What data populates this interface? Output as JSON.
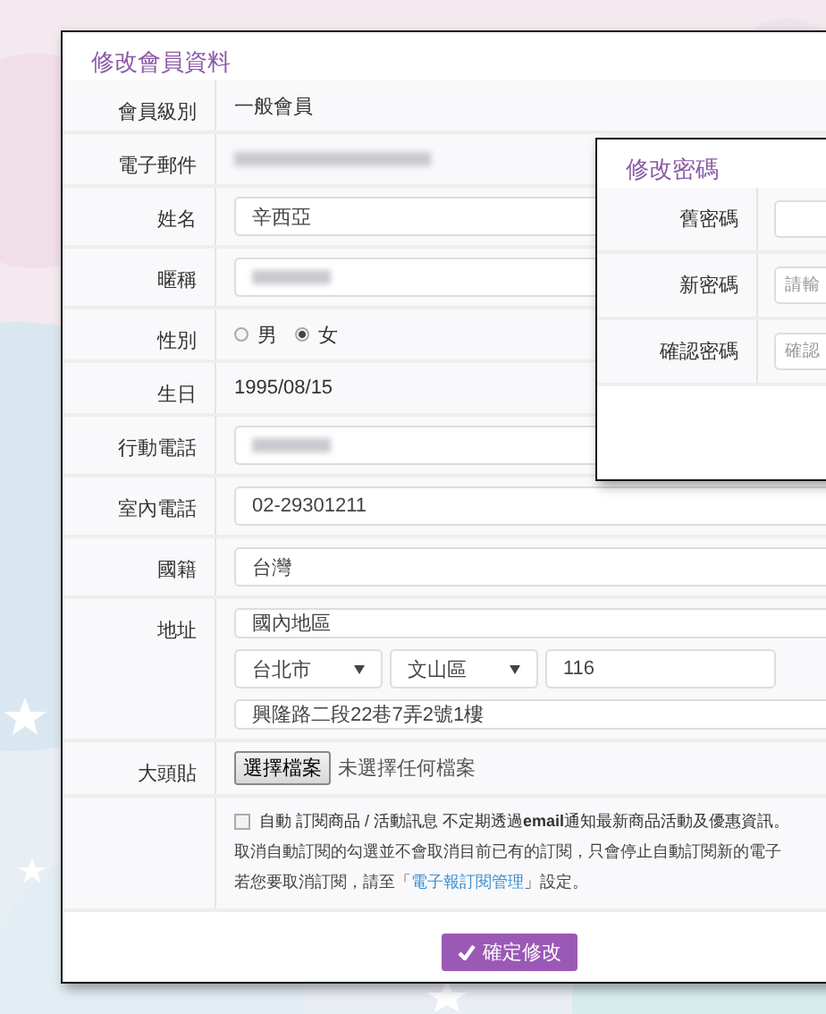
{
  "profile_dialog": {
    "title": "修改會員資料",
    "rows": [
      {
        "label": "會員級別",
        "kind": "text",
        "value": "一般會員"
      },
      {
        "label": "電子郵件",
        "kind": "blurred"
      },
      {
        "label": "姓名",
        "kind": "input",
        "value": "辛西亞"
      },
      {
        "label": "暱稱",
        "kind": "blurred_input"
      },
      {
        "label": "性別",
        "kind": "radio",
        "options": [
          {
            "label": "男",
            "selected": false
          },
          {
            "label": "女",
            "selected": true
          }
        ]
      },
      {
        "label": "生日",
        "kind": "text",
        "value": "1995/08/15"
      },
      {
        "label": "行動電話",
        "kind": "blurred_input"
      },
      {
        "label": "室內電話",
        "kind": "input",
        "value": "02-29301211"
      },
      {
        "label": "國籍",
        "kind": "input",
        "value": "台灣"
      },
      {
        "label": "地址",
        "kind": "address",
        "region": "國內地區",
        "city": "台北市",
        "district": "文山區",
        "zip": "116",
        "street": "興隆路二段22巷7弄2號1樓"
      },
      {
        "label": "大頭貼",
        "kind": "file",
        "button": "選擇檔案",
        "status": "未選擇任何檔案"
      },
      {
        "kind": "subscribe",
        "checked": false,
        "text": "自動 訂閱商品 / 活動訊息 不定期透過**email**通知最新商品活動及優惠資訊。",
        "note": "取消自動訂閱的勾選並不會取消目前已有的訂閱，只會停止自動訂閱新的電子",
        "note2_prefix": "若您要取消訂閱，請至「",
        "link": "電子報訂閱管理",
        "note2_suffix": "」設定。"
      }
    ],
    "submit": "確定修改"
  },
  "password_dialog": {
    "title": "修改密碼",
    "rows": [
      {
        "label": "舊密碼"
      },
      {
        "label": "新密碼",
        "placeholder": "請輸"
      },
      {
        "label": "確認密碼",
        "placeholder": "確認"
      }
    ]
  }
}
